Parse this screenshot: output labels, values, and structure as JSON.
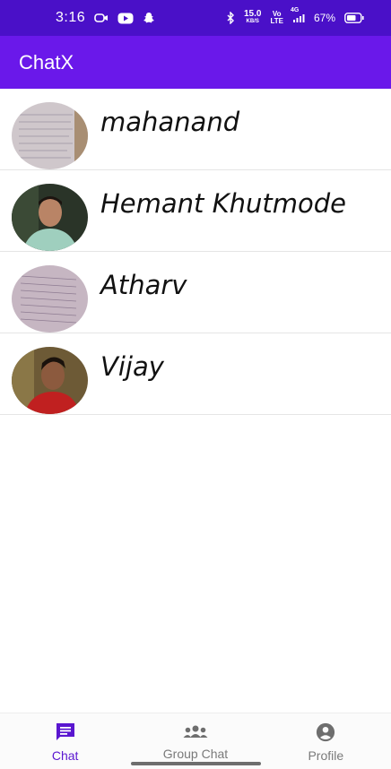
{
  "status_bar": {
    "time": "3:16",
    "speed_value": "15.0",
    "speed_unit": "KB/S",
    "volte_top": "Vo",
    "volte_bottom": "LTE",
    "network": "4G",
    "battery": "67%",
    "left_icons": [
      "video-call-icon",
      "youtube-icon",
      "snapchat-icon"
    ],
    "right_icons": [
      "bluetooth-icon",
      "signal-icon",
      "battery-icon"
    ]
  },
  "app_bar": {
    "title": "ChatX",
    "background": "#6a18ea"
  },
  "contacts": [
    {
      "name": "mahanand",
      "avatar": "notebook-photo"
    },
    {
      "name": "Hemant Khutmode",
      "avatar": "person-photo"
    },
    {
      "name": "Atharv",
      "avatar": "notebook-photo"
    },
    {
      "name": "Vijay",
      "avatar": "person-photo"
    }
  ],
  "bottom_nav": {
    "items": [
      {
        "label": "Chat",
        "icon": "chat-icon",
        "active": true
      },
      {
        "label": "Group Chat",
        "icon": "group-icon",
        "active": false
      },
      {
        "label": "Profile",
        "icon": "profile-icon",
        "active": false
      }
    ],
    "active_color": "#5a16d0",
    "inactive_color": "#7a7a7a"
  }
}
